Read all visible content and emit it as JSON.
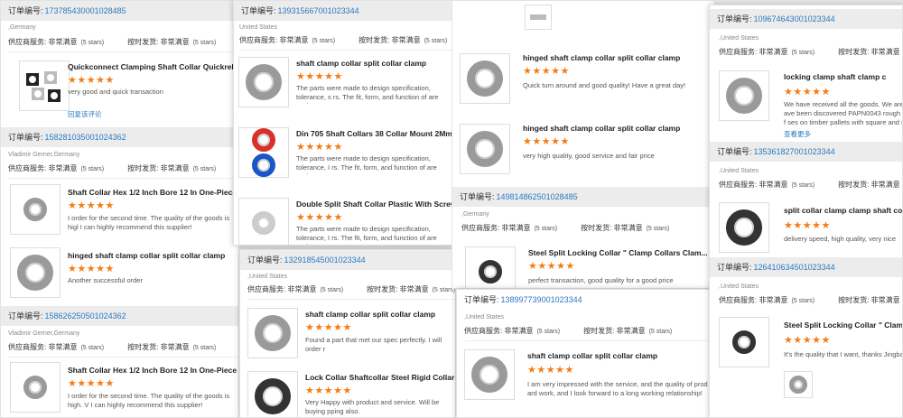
{
  "labels": {
    "order_no": "订单编号:",
    "supplier_service": "供应商服务: 非常满意",
    "on_time": "按时发货: 非常满意",
    "five_stars": "(5 stars)",
    "follow_up": "回复该评论",
    "view_more": "查看更多"
  },
  "stars": "★★★★★",
  "colors": {
    "star": "#f57b14",
    "link": "#2a7ac0",
    "header_bg": "#ececec"
  },
  "p1": {
    "order1": "173785430001028485",
    "country1": ",Germany",
    "prod1_title": "Quickconnect Clamping Shaft Collar Quickrele...",
    "prod1_text": "very good and quick transaction",
    "order2": "158281035001024362",
    "buyer2": "Vladimir Gerner,Germany",
    "prod2_title": "Shaft Collar Hex 1/2 Inch Bore 12 In One-Piece",
    "prod2_text": "I order for the second time. The quality of the goods is higl I can highly recommend this supplier!",
    "prod3_title": "hinged shaft clamp collar split collar clamp",
    "prod3_text": "Another successful order",
    "order3": "158626250501024362",
    "buyer3": "Vladimir Gerner,Germany",
    "prod4_title": "Shaft Collar Hex 1/2 Inch Bore 12 In One-Piece",
    "prod4_text": "I order for the second time. The quality of the goods is high. V I can highly recommend this supplier!"
  },
  "p2": {
    "order1": "139315667001023344",
    "country1": "United States",
    "prod1_title": "shaft clamp collar split collar clamp",
    "prod1_text": "The parts were made to design specification, tolerance, s rs. The fit, form, and function of are perfect.",
    "prod2_title": "Din 705 Shaft Collars 38 Collar Mount 2Mm Ny...",
    "prod2_text": "The parts were made to design specification, tolerance, I rs. The fit, form, and function of are perfect.",
    "prod3_title": "Double Split Shaft Collar Plastic With Screw Sp...",
    "prod3_text": "The parts were made to design specification, tolerance, I rs. The fit, form, and function of are perfect."
  },
  "p3": {
    "order1": "132918545001023344",
    "country1": ",United States",
    "prod1_title": "shaft clamp collar split collar clamp",
    "prod1_text": "Found a part that met our spec perfectly. I will order r",
    "prod2_title": "Lock Collar Shaftcollar Steel Rigid Collars Loc...",
    "prod2_text": "Very Happy with product and service. Will be buying pping also."
  },
  "p4": {
    "prod1_title": "hinged shaft clamp collar split collar clamp",
    "prod1_text": "Quick turn around and good quality! Have a great day!",
    "prod2_title": "hinged shaft clamp collar split collar clamp",
    "prod2_text": "very high quality, good service and fair price",
    "order1": "149814862501028485",
    "country1": ",Germany",
    "prod3_title": "Steel Split Locking Collar \" Clamp Collars Clam...",
    "prod3_text": "perfect transaction, good quality for a good price"
  },
  "p5": {
    "order1": "138997739001023344",
    "country1": ",United States",
    "prod1_title": "shaft clamp collar split collar clamp",
    "prod1_text": "I am very impressed with the service, and the quality of prod ard work, and I look forward to a long working relationship!"
  },
  "p6": {
    "order1": "109674643001023344",
    "country1": ",United States",
    "prod1_title": "locking clamp shaft clamp c",
    "prod1_text": "We have received all the goods. We are ave been discovered PAPN0043 rough f ses on timber pallets with square and r",
    "order2": "135361827001023344",
    "country2": ",United States",
    "prod2_title": "split collar clamp clamp shaft coll",
    "prod2_text": "delivery speed, high quality, very nice",
    "order3": "126410634501023344",
    "country3": ",United States",
    "prod3_title": "Steel Split Locking Collar \" Clamp C",
    "prod3_text": "It's the quality that I want, thanks Jingba"
  }
}
